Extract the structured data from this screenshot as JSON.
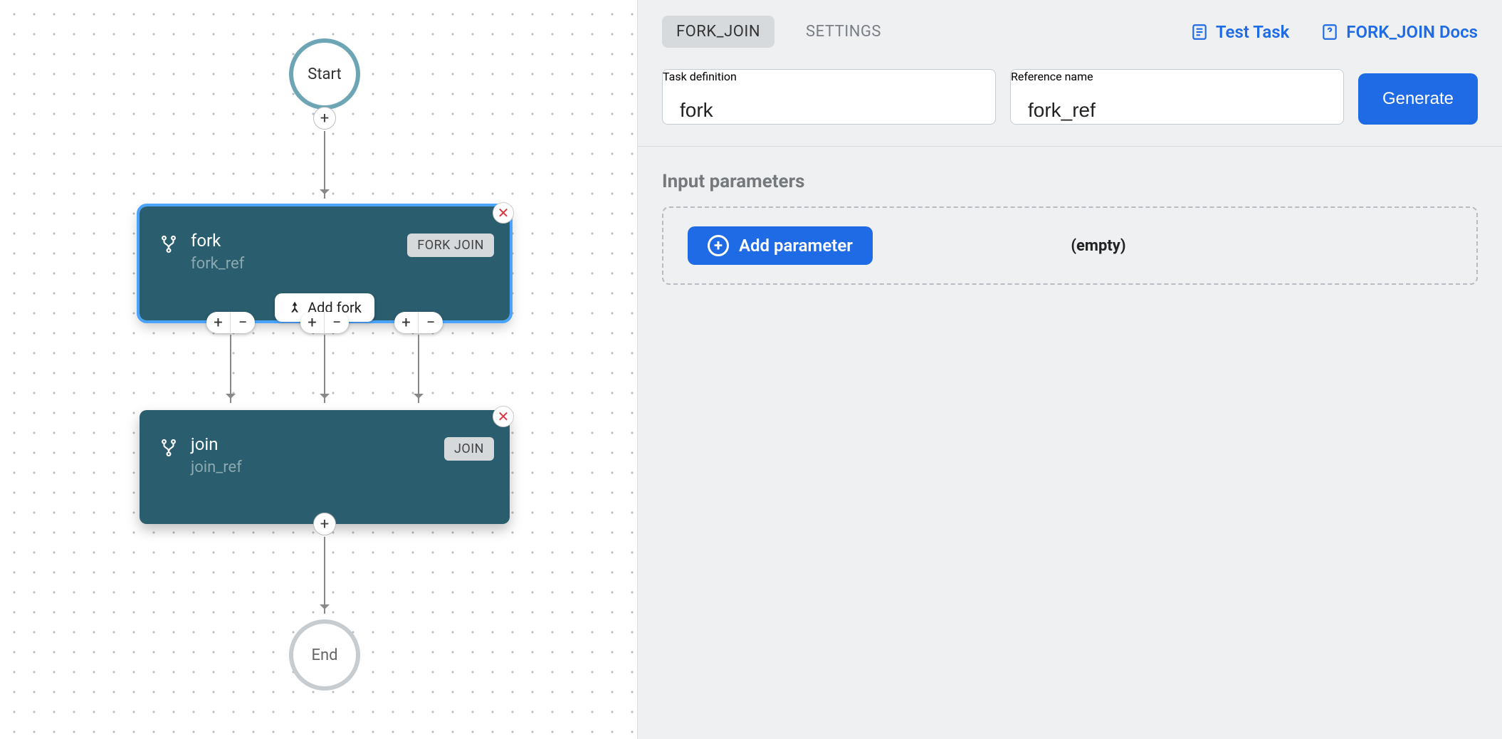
{
  "canvas": {
    "start_label": "Start",
    "end_label": "End",
    "fork_node": {
      "title": "fork",
      "ref": "fork_ref",
      "type_badge": "FORK JOIN",
      "add_fork_label": "Add fork"
    },
    "join_node": {
      "title": "join",
      "ref": "join_ref",
      "type_badge": "JOIN"
    }
  },
  "panel": {
    "tabs": {
      "fork_join": "FORK_JOIN",
      "settings": "SETTINGS"
    },
    "links": {
      "test_task": "Test Task",
      "docs": "FORK_JOIN Docs"
    },
    "fields": {
      "task_def_label": "Task definition",
      "task_def_value": "fork",
      "ref_name_label": "Reference name",
      "ref_name_value": "fork_ref"
    },
    "generate_label": "Generate",
    "section_title": "Input parameters",
    "add_param_label": "Add parameter",
    "empty_label": "(empty)"
  }
}
